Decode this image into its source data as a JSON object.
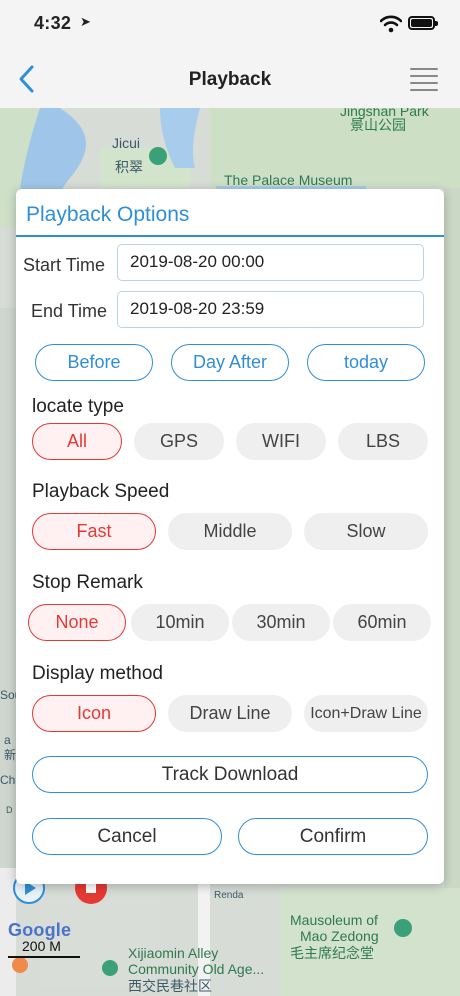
{
  "status": {
    "time": "4:32"
  },
  "nav": {
    "title": "Playback"
  },
  "map": {
    "labels": {
      "jicui": "Jicui",
      "jicui_cn": "积翠",
      "jingshan": "Jingshan Park",
      "jingshan_cn": "景山公园",
      "palace": "The Palace Museum",
      "mausoleum": "Mausoleum of",
      "mao": "Mao Zedong",
      "mao_cn": "毛主席纪念堂",
      "xijiaomin": "Xijiaomin Alley",
      "community": "Community Old Age...",
      "bottom_cn": "西交民巷社区",
      "renda": "Renda",
      "left_s": "Sou",
      "left_cha": "Cha",
      "left_d": "D",
      "left_a": "a",
      "left_cn": "新"
    },
    "google": "Google",
    "scale": "200 M"
  },
  "modal": {
    "title": "Playback Options",
    "start_label": "Start Time",
    "start_value": "2019-08-20 00:00",
    "end_label": "End Time",
    "end_value": "2019-08-20 23:59",
    "quick": [
      "Before",
      "Day After",
      "today"
    ],
    "locate_label": "locate type",
    "locate_options": [
      "All",
      "GPS",
      "WIFI",
      "LBS"
    ],
    "speed_label": "Playback Speed",
    "speed_options": [
      "Fast",
      "Middle",
      "Slow"
    ],
    "stop_label": "Stop Remark",
    "stop_options": [
      "None",
      "10min",
      "30min",
      "60min"
    ],
    "display_label": "Display method",
    "display_options": [
      "Icon",
      "Draw Line",
      "Icon+Draw Line"
    ],
    "track_download": "Track Download",
    "cancel": "Cancel",
    "confirm": "Confirm"
  },
  "colors": {
    "accent": "#2f8fd6",
    "selected": "#e53935"
  }
}
